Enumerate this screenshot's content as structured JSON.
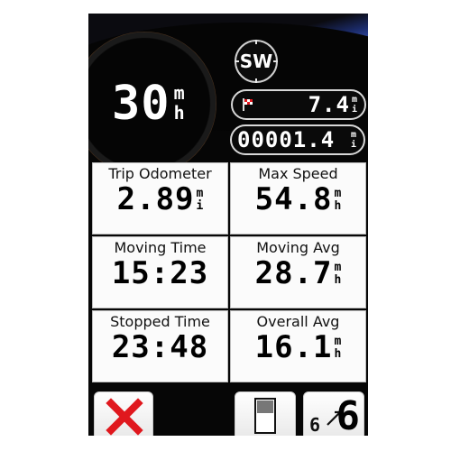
{
  "top": {
    "speed": {
      "value": "30",
      "unit_top": "m",
      "unit_bottom": "h"
    },
    "compass": {
      "heading": "SW"
    },
    "distance_to_destination": {
      "value": "7.4",
      "unit_top": "m",
      "unit_bottom": "i",
      "icon": "checkered-flag-icon"
    },
    "odometer": {
      "value": "00001.4",
      "unit_top": "m",
      "unit_bottom": "i"
    }
  },
  "fields": [
    {
      "label": "Trip Odometer",
      "value": "2.89",
      "unit_top": "m",
      "unit_bottom": "i"
    },
    {
      "label": "Max Speed",
      "value": "54.8",
      "unit_top": "m",
      "unit_bottom": "h"
    },
    {
      "label": "Moving Time",
      "value": "15:23"
    },
    {
      "label": "Moving Avg",
      "value": "28.7",
      "unit_top": "m",
      "unit_bottom": "h"
    },
    {
      "label": "Stopped Time",
      "value": "23:48"
    },
    {
      "label": "Overall Avg",
      "value": "16.1",
      "unit_top": "m",
      "unit_bottom": "h"
    }
  ],
  "buttons": {
    "close": {
      "icon": "close-icon",
      "color": "#e0181e"
    },
    "page": {
      "icon": "page-layout-icon"
    },
    "fields": {
      "icon": "data-fields-count-icon",
      "from": "6",
      "to": "6"
    }
  },
  "colors": {
    "background": "#060606",
    "field_background": "#fbfbfb",
    "dial_ring": "#d8792d"
  }
}
